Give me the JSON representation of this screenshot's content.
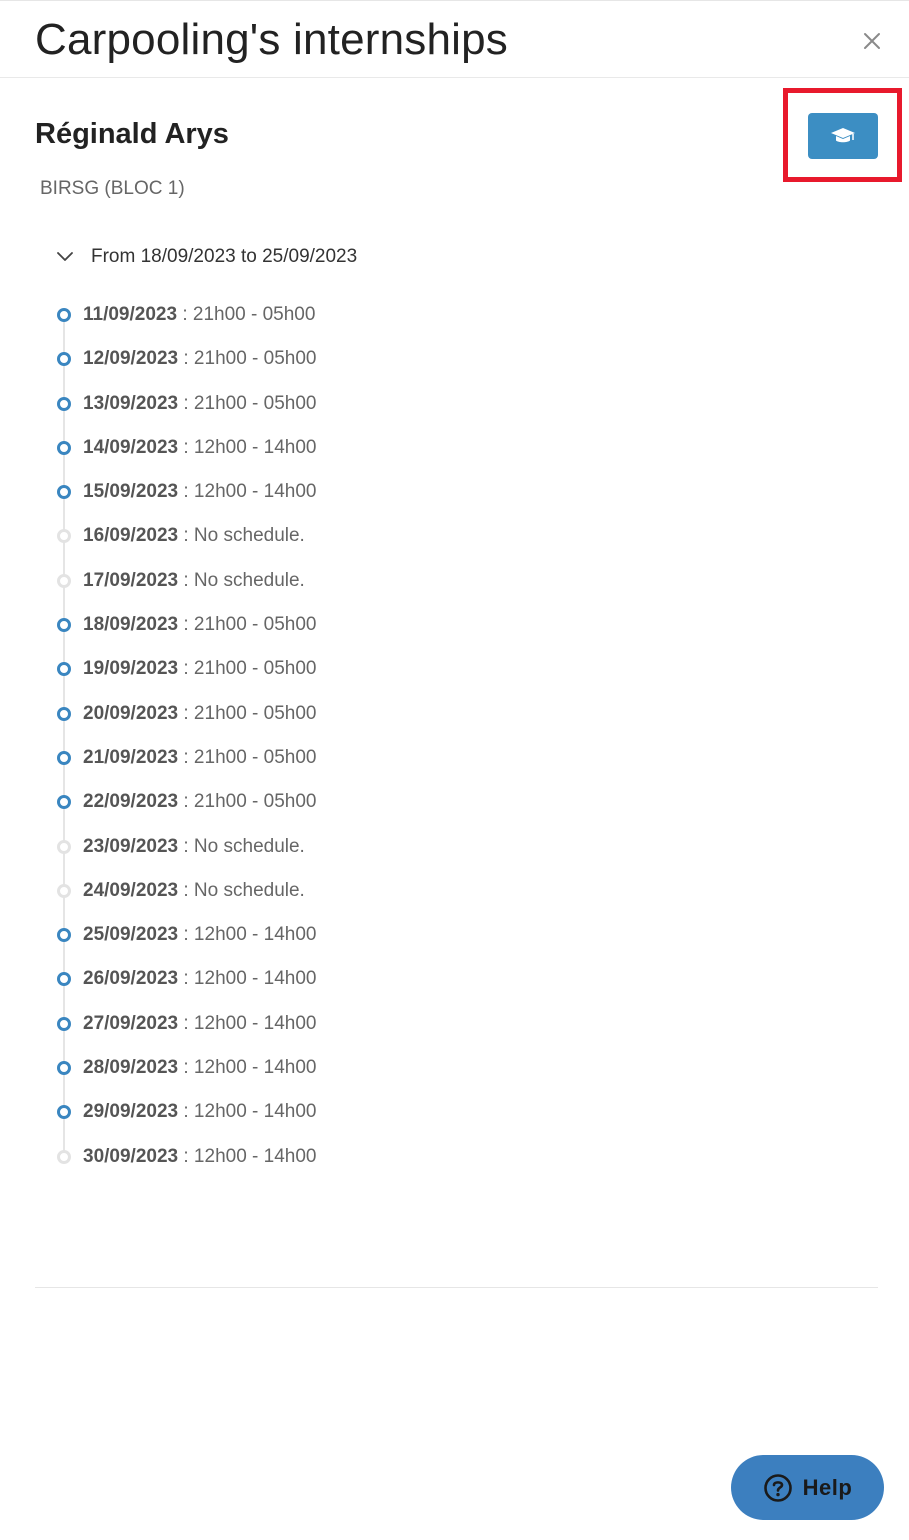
{
  "header": {
    "title": "Carpooling's internships",
    "close_icon": "close-icon"
  },
  "student": {
    "name": "Réginald Arys",
    "group": "BIRSG (BLOC 1)"
  },
  "actions": {
    "internship_button_icon": "graduation-cap-icon",
    "highlight_color": "#e8192c",
    "accent_color": "#3c8ec3"
  },
  "period": {
    "label": "From 18/09/2023 to 25/09/2023",
    "expanded": true
  },
  "schedule": [
    {
      "date": "11/09/2023",
      "text": " : 21h00 - 05h00",
      "active": true
    },
    {
      "date": "12/09/2023",
      "text": " : 21h00 - 05h00",
      "active": true
    },
    {
      "date": "13/09/2023",
      "text": " : 21h00 - 05h00",
      "active": true
    },
    {
      "date": "14/09/2023",
      "text": " : 12h00 - 14h00",
      "active": true
    },
    {
      "date": "15/09/2023",
      "text": " : 12h00 - 14h00",
      "active": true
    },
    {
      "date": "16/09/2023",
      "text": " : No schedule.",
      "active": false
    },
    {
      "date": "17/09/2023",
      "text": " : No schedule.",
      "active": false
    },
    {
      "date": "18/09/2023",
      "text": " : 21h00 - 05h00",
      "active": true
    },
    {
      "date": "19/09/2023",
      "text": " : 21h00 - 05h00",
      "active": true
    },
    {
      "date": "20/09/2023",
      "text": " : 21h00 - 05h00",
      "active": true
    },
    {
      "date": "21/09/2023",
      "text": " : 21h00 - 05h00",
      "active": true
    },
    {
      "date": "22/09/2023",
      "text": " : 21h00 - 05h00",
      "active": true
    },
    {
      "date": "23/09/2023",
      "text": " : No schedule.",
      "active": false
    },
    {
      "date": "24/09/2023",
      "text": " : No schedule.",
      "active": false
    },
    {
      "date": "25/09/2023",
      "text": " : 12h00 - 14h00",
      "active": true
    },
    {
      "date": "26/09/2023",
      "text": " : 12h00 - 14h00",
      "active": true
    },
    {
      "date": "27/09/2023",
      "text": " : 12h00 - 14h00",
      "active": true
    },
    {
      "date": "28/09/2023",
      "text": " : 12h00 - 14h00",
      "active": true
    },
    {
      "date": "29/09/2023",
      "text": " : 12h00 - 14h00",
      "active": true
    },
    {
      "date": "30/09/2023",
      "text": " : 12h00 - 14h00",
      "active": false
    }
  ],
  "help": {
    "label": "Help",
    "icon": "question-circle-icon"
  }
}
